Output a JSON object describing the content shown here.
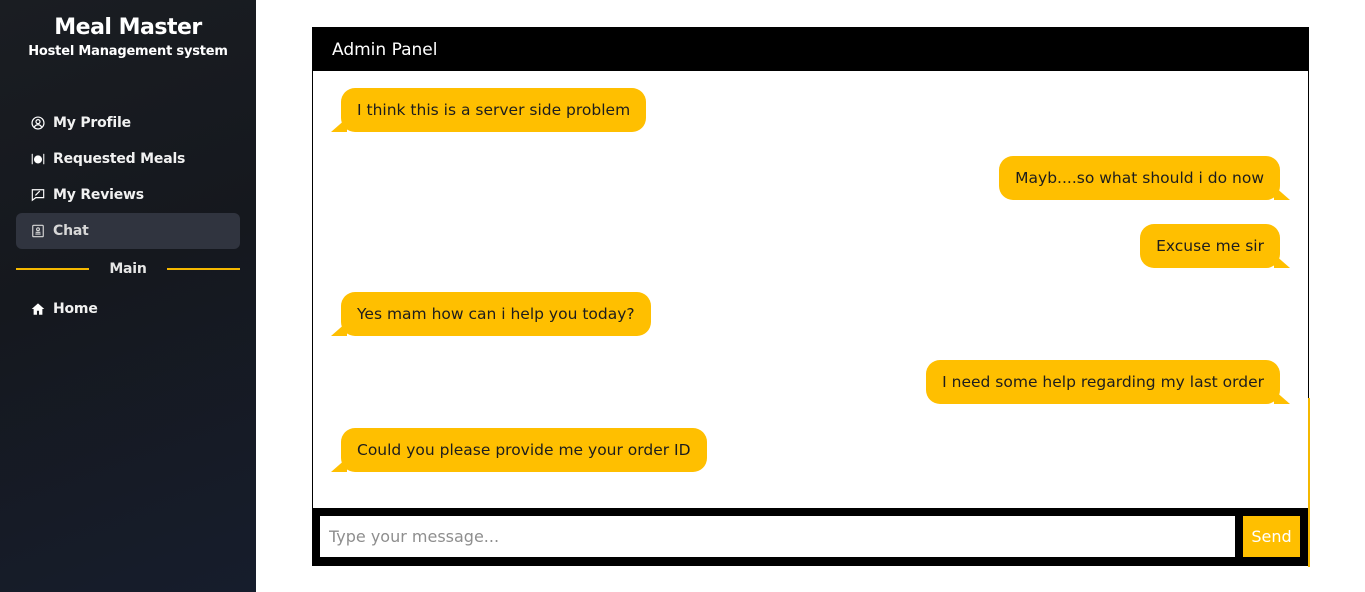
{
  "sidebar": {
    "title": "Meal Master",
    "subtitle": "Hostel Management system",
    "items": [
      {
        "label": "My Profile",
        "icon": "user-circle-icon"
      },
      {
        "label": "Requested Meals",
        "icon": "meal-plate-icon"
      },
      {
        "label": "My Reviews",
        "icon": "review-icon"
      },
      {
        "label": "Chat",
        "icon": "chat-icon",
        "active": true
      }
    ],
    "divider_label": "Main",
    "main_items": [
      {
        "label": "Home",
        "icon": "home-icon"
      }
    ]
  },
  "chat": {
    "header": "Admin Panel",
    "messages": [
      {
        "text": "I think this is a server side problem",
        "side": "left"
      },
      {
        "text": "Mayb....so what should i do now",
        "side": "right"
      },
      {
        "text": "Excuse me sir",
        "side": "right"
      },
      {
        "text": "Yes mam how can i help you today?",
        "side": "left"
      },
      {
        "text": "I need some help regarding my last order",
        "side": "right"
      },
      {
        "text": "Could you please provide me your order ID",
        "side": "left"
      }
    ],
    "input_placeholder": "Type your message...",
    "input_value": "",
    "send_label": "Send"
  },
  "colors": {
    "accent": "#ffbf00",
    "sidebar_bg": "#16191f",
    "header_bg": "#000000"
  }
}
